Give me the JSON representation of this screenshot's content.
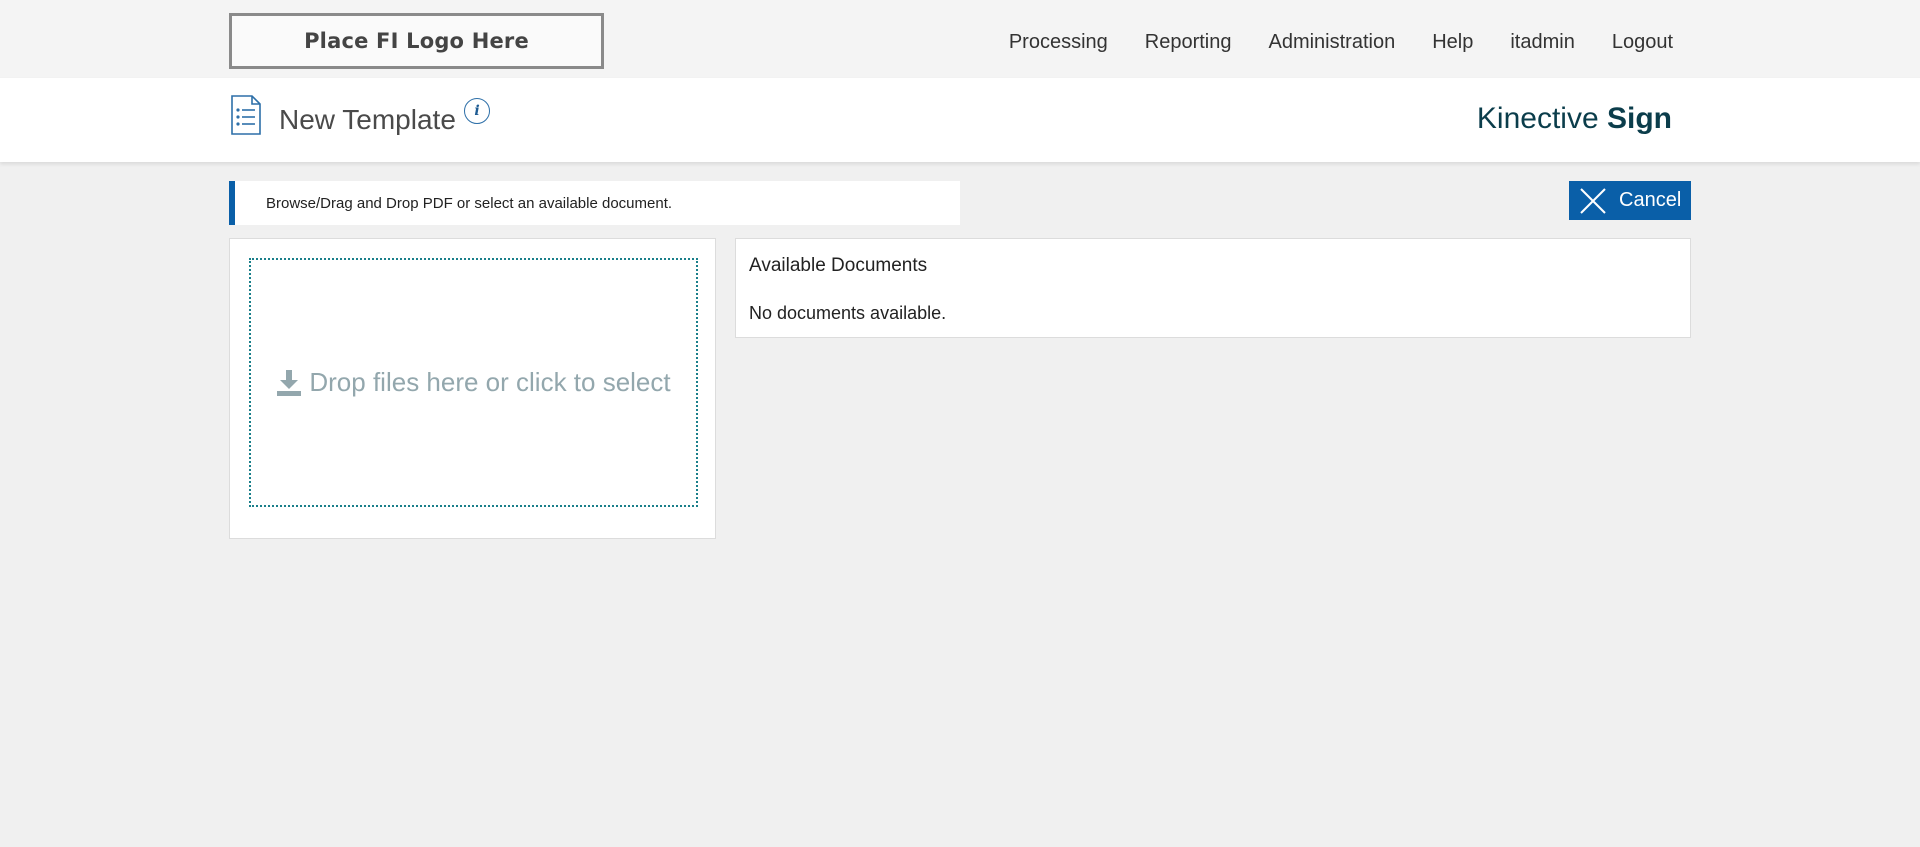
{
  "logo": {
    "text": "Place FI Logo Here"
  },
  "nav": {
    "items": [
      {
        "label": "Processing"
      },
      {
        "label": "Reporting"
      },
      {
        "label": "Administration"
      },
      {
        "label": "Help"
      },
      {
        "label": "itadmin"
      },
      {
        "label": "Logout"
      }
    ]
  },
  "header": {
    "title": "New Template",
    "title_icon": "document-list-icon",
    "info_icon": "info-icon",
    "info_glyph": "i",
    "brand_light": "Kinective",
    "brand_bold": "Sign"
  },
  "instruction": {
    "text": "Browse/Drag and Drop PDF or select an available document."
  },
  "cancel": {
    "label": "Cancel",
    "icon": "close-icon"
  },
  "upload": {
    "prompt": "Drop files here or click to select",
    "icon": "download-icon"
  },
  "documents": {
    "title": "Available Documents",
    "empty_text": "No documents available."
  },
  "colors": {
    "accent": "#0a5fa8",
    "brand": "#0b3d4b",
    "dropzone_border": "#1a7f8a",
    "dropzone_text": "#93a7ad"
  }
}
